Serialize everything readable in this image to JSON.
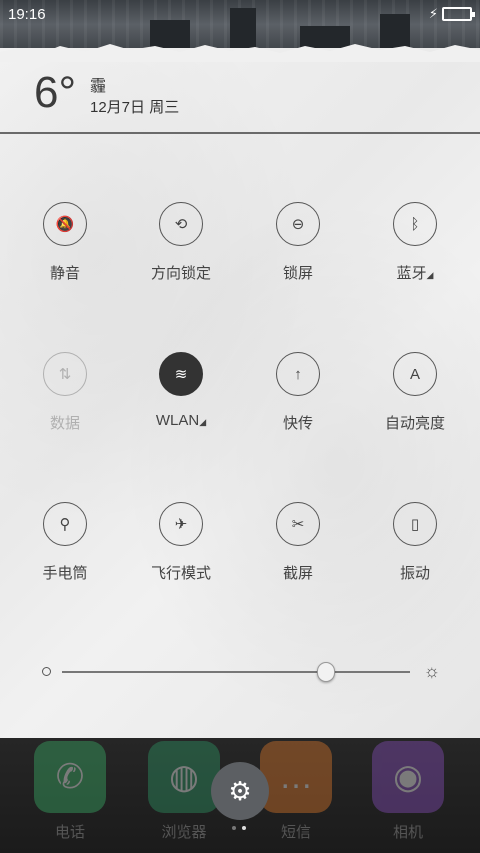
{
  "status_bar": {
    "time": "19:16",
    "battery_color": "#2ee06b"
  },
  "weather": {
    "temperature": "6°",
    "condition": "霾",
    "date": "12月7日 周三"
  },
  "toggles": [
    {
      "label": "静音",
      "icon": "bell-off-icon",
      "glyph": "🔕",
      "state": "off"
    },
    {
      "label": "方向锁定",
      "icon": "rotation-lock-icon",
      "glyph": "⟲",
      "state": "off"
    },
    {
      "label": "锁屏",
      "icon": "lock-icon",
      "glyph": "⊖",
      "state": "off"
    },
    {
      "label": "蓝牙",
      "icon": "bluetooth-icon",
      "glyph": "ᛒ",
      "state": "off",
      "has_more": true
    },
    {
      "label": "数据",
      "icon": "mobile-data-icon",
      "glyph": "⇅",
      "state": "disabled"
    },
    {
      "label": "WLAN",
      "icon": "wifi-icon",
      "glyph": "≋",
      "state": "on",
      "has_more": true
    },
    {
      "label": "快传",
      "icon": "quick-transfer-icon",
      "glyph": "↑",
      "state": "off"
    },
    {
      "label": "自动亮度",
      "icon": "auto-brightness-icon",
      "glyph": "A",
      "state": "off"
    },
    {
      "label": "手电筒",
      "icon": "flashlight-icon",
      "glyph": "⚲",
      "state": "off"
    },
    {
      "label": "飞行模式",
      "icon": "airplane-icon",
      "glyph": "✈",
      "state": "off"
    },
    {
      "label": "截屏",
      "icon": "screenshot-icon",
      "glyph": "✂",
      "state": "off"
    },
    {
      "label": "振动",
      "icon": "vibrate-icon",
      "glyph": "▯",
      "state": "off"
    }
  ],
  "brightness": {
    "level": 0.76
  },
  "dock": [
    {
      "label": "电话",
      "icon": "phone-icon",
      "glyph": "✆",
      "color": "#3bb56a"
    },
    {
      "label": "浏览器",
      "icon": "browser-icon",
      "glyph": "◍",
      "color": "#2e9a67"
    },
    {
      "label": "短信",
      "icon": "sms-icon",
      "glyph": "…",
      "color": "#e47b2b"
    },
    {
      "label": "相机",
      "icon": "camera-icon",
      "glyph": "◉",
      "color": "#8a4fc0"
    }
  ],
  "pager": {
    "pages": 2,
    "current": 1
  }
}
